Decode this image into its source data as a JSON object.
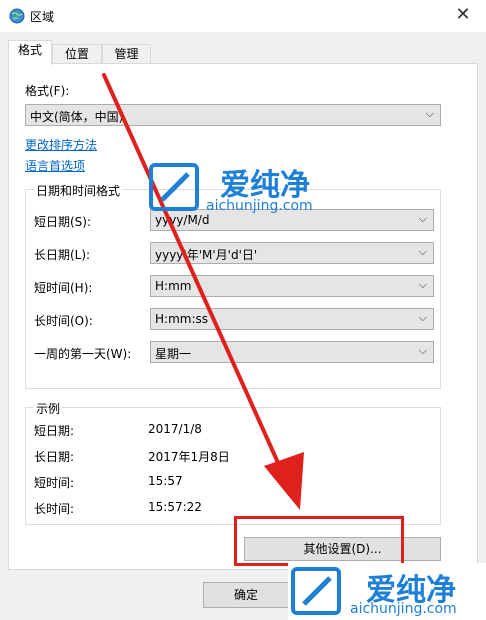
{
  "window": {
    "title": "区域",
    "close_glyph": "✕"
  },
  "tabs": [
    {
      "label": "格式"
    },
    {
      "label": "位置"
    },
    {
      "label": "管理"
    }
  ],
  "format_section": {
    "label": "格式(F):",
    "selected": "中文(简体，中国)",
    "link_sort": "更改排序方法",
    "link_language": "语言首选项"
  },
  "datetime_group": {
    "title": "日期和时间格式",
    "rows": [
      {
        "label": "短日期(S):",
        "value": "yyyy/M/d"
      },
      {
        "label": "长日期(L):",
        "value": "yyyy'年'M'月'd'日'"
      },
      {
        "label": "短时间(H):",
        "value": "H:mm"
      },
      {
        "label": "长时间(O):",
        "value": "H:mm:ss"
      },
      {
        "label": "一周的第一天(W):",
        "value": "星期一"
      }
    ]
  },
  "example_group": {
    "title": "示例",
    "rows": [
      {
        "label": "短日期:",
        "value": "2017/1/8"
      },
      {
        "label": "长日期:",
        "value": "2017年1月8日"
      },
      {
        "label": "短时间:",
        "value": "15:57"
      },
      {
        "label": "长时间:",
        "value": "15:57:22"
      }
    ]
  },
  "buttons": {
    "other_settings": "其他设置(D)...",
    "ok": "确定"
  },
  "watermark": {
    "brand": "爱纯净",
    "url": "aichunjing.com"
  },
  "colors": {
    "accent_red": "#e0201d",
    "link_blue": "#0066cc",
    "watermark_blue": "#1e7fd6"
  },
  "icons": {
    "app": "globe-icon",
    "dropdown": "chevron-down-icon",
    "close": "close-icon"
  }
}
